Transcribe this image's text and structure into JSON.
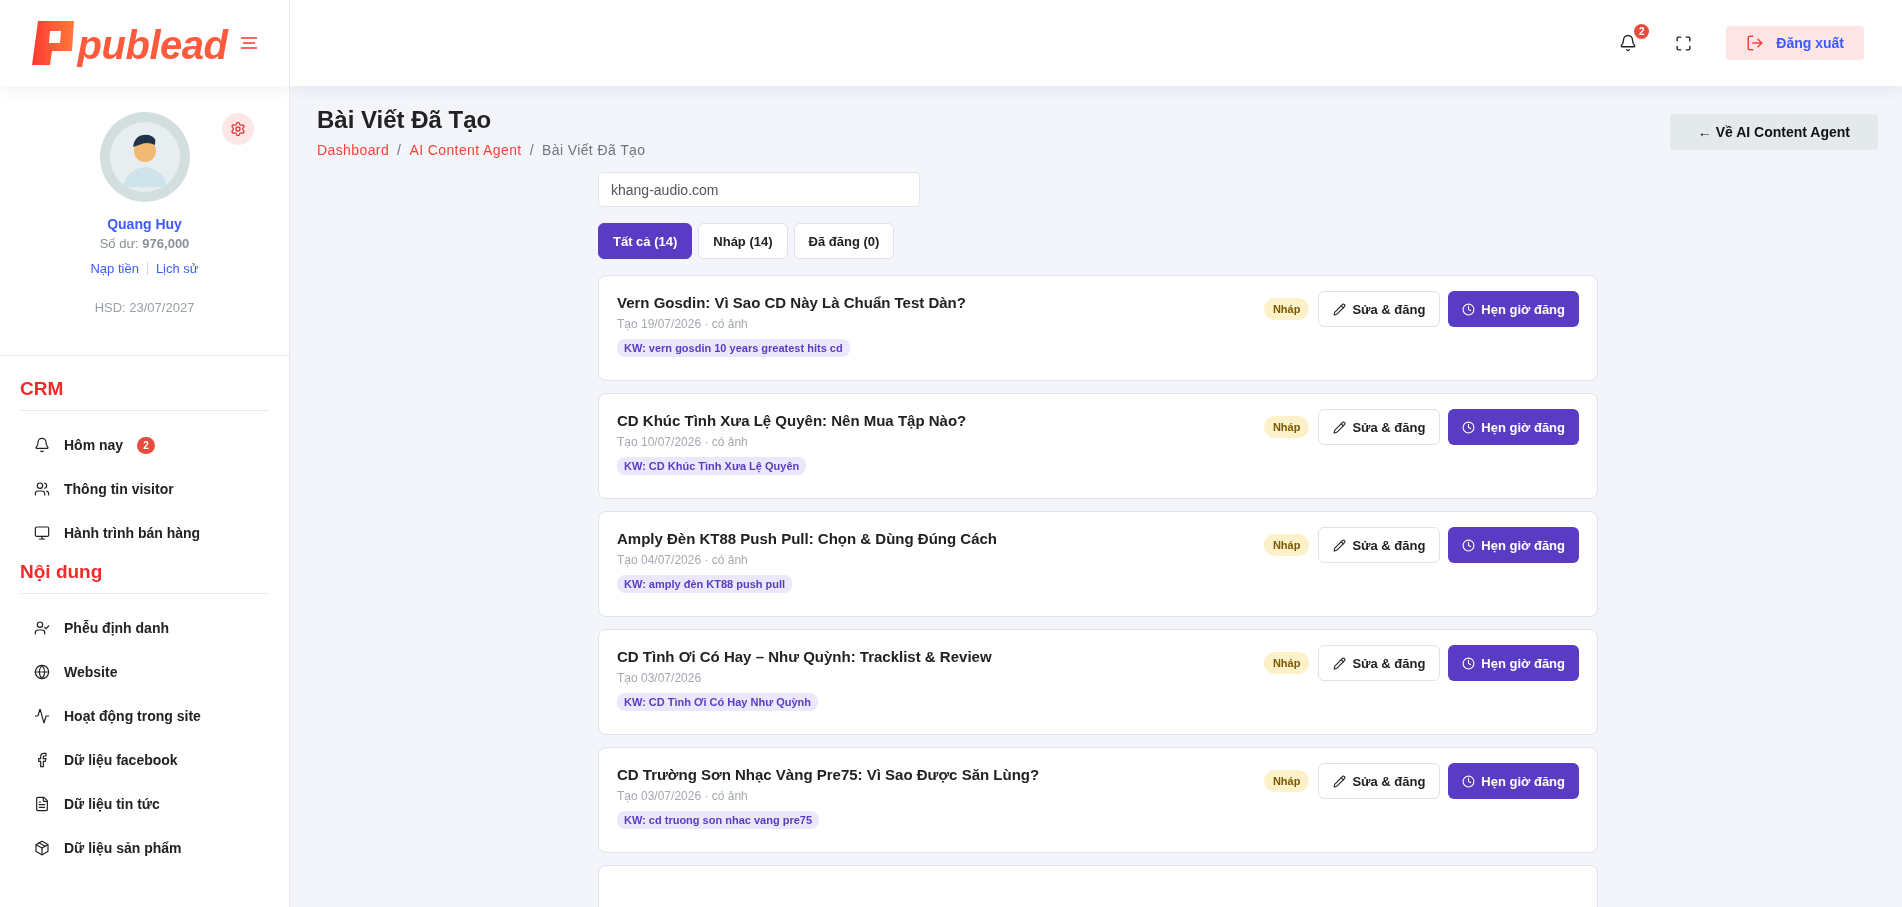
{
  "logo": {
    "text": "publead"
  },
  "header": {
    "notification_count": "2",
    "logout": "Đăng xuất"
  },
  "profile": {
    "name": "Quang Huy",
    "balance_label": "Số dư:",
    "balance": "976,000",
    "links": [
      "Nạp tiền",
      "Lịch sử"
    ],
    "expiry": "HSD: 23/07/2027"
  },
  "sidebar": {
    "sections": [
      {
        "title": "CRM",
        "items": [
          {
            "label": "Hôm nay",
            "badge": "2"
          },
          {
            "label": "Thông tin visitor"
          },
          {
            "label": "Hành trình bán hàng"
          }
        ]
      },
      {
        "title": "Nội dung",
        "items": [
          {
            "label": "Phễu định danh"
          },
          {
            "label": "Website"
          },
          {
            "label": "Hoạt động trong site"
          },
          {
            "label": "Dữ liệu facebook"
          },
          {
            "label": "Dữ liệu tin tức"
          },
          {
            "label": "Dữ liệu sản phẩm"
          }
        ]
      }
    ]
  },
  "page": {
    "title": "Bài Viết Đã Tạo",
    "breadcrumb": [
      "Dashboard",
      "AI Content Agent",
      "Bài Viết Đã Tạo"
    ],
    "breadcrumb_separator": "/",
    "back_button": "← Về AI Content Agent"
  },
  "site_field": {
    "value": "khang-audio.com"
  },
  "tabs": [
    {
      "label": "Tất cả (14)",
      "selected": true
    },
    {
      "label": "Nháp (14)",
      "selected": false
    },
    {
      "label": "Đã đăng (0)",
      "selected": false
    }
  ],
  "posts": [
    {
      "title": "Vern Gosdin: Vì Sao CD Này Là Chuẩn Test Dàn?",
      "meta": "Tạo 19/07/2026 · có ảnh",
      "keyword": "KW: vern gosdin 10 years greatest hits cd",
      "status": "Nháp",
      "edit": "Sửa & đăng",
      "schedule": "Hẹn giờ đăng"
    },
    {
      "title": "CD Khúc Tình Xưa Lệ Quyên: Nên Mua Tập Nào?",
      "meta": "Tạo 10/07/2026 · có ảnh",
      "keyword": "KW: CD Khúc Tình Xưa Lệ Quyên",
      "status": "Nháp",
      "edit": "Sửa & đăng",
      "schedule": "Hẹn giờ đăng"
    },
    {
      "title": "Amply Đèn KT88 Push Pull: Chọn & Dùng Đúng Cách",
      "meta": "Tạo 04/07/2026 · có ảnh",
      "keyword": "KW: amply đèn KT88 push pull",
      "status": "Nháp",
      "edit": "Sửa & đăng",
      "schedule": "Hẹn giờ đăng"
    },
    {
      "title": "CD Tình Ơi Có Hay – Như Quỳnh: Tracklist & Review",
      "meta": "Tạo 03/07/2026",
      "keyword": "KW: CD Tình Ơi Có Hay Như Quỳnh",
      "status": "Nháp",
      "edit": "Sửa & đăng",
      "schedule": "Hẹn giờ đăng"
    },
    {
      "title": "CD Trường Sơn Nhạc Vàng Pre75: Vì Sao Được Săn Lùng?",
      "meta": "Tạo 03/07/2026 · có ảnh",
      "keyword": "KW: cd truong son nhac vang pre75",
      "status": "Nháp",
      "edit": "Sửa & đăng",
      "schedule": "Hẹn giờ đăng"
    }
  ]
}
